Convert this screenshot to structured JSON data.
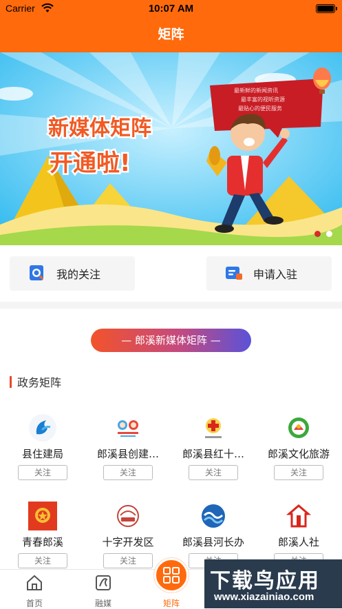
{
  "status_bar": {
    "carrier": "Carrier",
    "time": "10:07 AM"
  },
  "nav": {
    "title": "矩阵"
  },
  "banner": {
    "headline_1": "新媒体矩阵",
    "headline_2": "开通啦!",
    "bubble_lines": [
      "最新鲜的新闻资讯",
      "最丰富的视听资源",
      "最贴心的便民服务"
    ],
    "slide_count": 2,
    "active_slide": 1
  },
  "quick_actions": [
    {
      "label": "我的关注",
      "icon": "search-doc-icon",
      "color": "#2f78e6"
    },
    {
      "label": "申请入驻",
      "icon": "apply-card-icon",
      "color": "#2f78e6"
    }
  ],
  "pill": {
    "label": "— 郎溪新媒体矩阵 —"
  },
  "section": {
    "title": "政务矩阵"
  },
  "accounts": [
    {
      "name": "县住建局",
      "follow": "关注",
      "icon": "housing-bureau-logo"
    },
    {
      "name": "郎溪县创建…",
      "follow": "关注",
      "icon": "civilization-mascot-logo"
    },
    {
      "name": "郎溪县红十…",
      "follow": "关注",
      "icon": "red-cross-logo"
    },
    {
      "name": "郎溪文化旅游",
      "follow": "关注",
      "icon": "culture-tourism-logo"
    },
    {
      "name": "青春郎溪",
      "follow": "关注",
      "icon": "youth-league-logo"
    },
    {
      "name": "十字开发区",
      "follow": "关注",
      "icon": "development-zone-logo"
    },
    {
      "name": "郎溪县河长办",
      "follow": "关注",
      "icon": "river-chief-logo"
    },
    {
      "name": "郎溪人社",
      "follow": "关注",
      "icon": "human-resources-logo"
    }
  ],
  "tabbar": {
    "items": [
      {
        "label": "首页",
        "icon": "home-icon"
      },
      {
        "label": "融媒",
        "icon": "media-icon"
      },
      {
        "label": "矩阵",
        "icon": "matrix-grid-icon"
      }
    ],
    "active_index": 2
  },
  "watermark": {
    "line1": "下载鸟应用",
    "line2": "www.xiazainiao.com"
  }
}
